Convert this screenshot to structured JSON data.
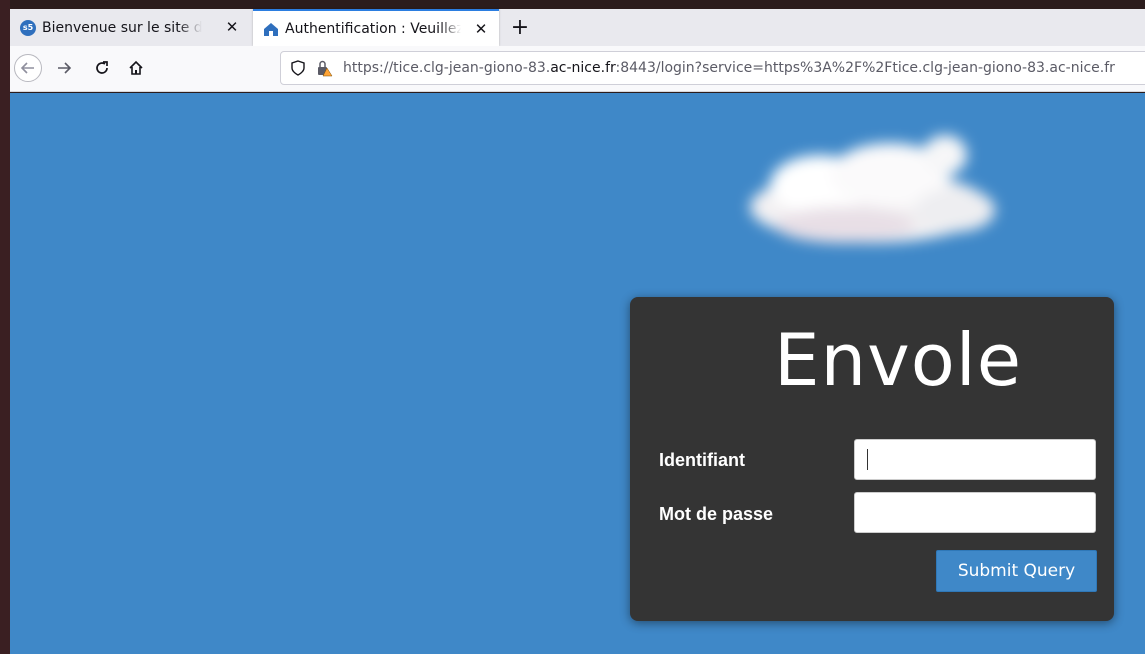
{
  "browser": {
    "tabs": [
      {
        "label": "Bienvenue sur le site du coll",
        "favicon": "s5"
      },
      {
        "label": "Authentification : Veuillez"
      }
    ],
    "new_tab_label": "+",
    "close_label": "✕",
    "url": {
      "prefix": "https://tice.clg-jean-giono-83.",
      "host": "ac-nice.fr",
      "suffix": ":8443/login?service=https%3A%2F%2Ftice.clg-jean-giono-83.ac-nice.fr"
    },
    "accent_color": "#2b7de0"
  },
  "page": {
    "background_color": "#3f88c8",
    "brand": "Envole",
    "username_label": "Identifiant",
    "password_label": "Mot de passe",
    "username_value": "",
    "password_value": "",
    "submit_label": "Submit Query"
  }
}
